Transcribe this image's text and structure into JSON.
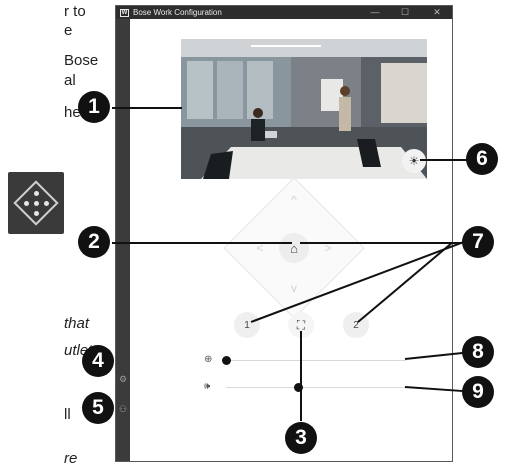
{
  "doc_text": {
    "lines_top": [
      "r to",
      "e",
      "Bose",
      "al",
      "here"
    ],
    "lines_mid": [
      "that",
      "utlet"
    ],
    "lines_low": [
      "ll",
      "re"
    ]
  },
  "window": {
    "title": "Bose Work Configuration",
    "logo_text": "W",
    "minimize": "—",
    "maximize": "☐",
    "close": "✕"
  },
  "sidebar": {
    "settings_icon": "⚙",
    "user_icon": "⚇"
  },
  "camera": {
    "brightness_icon": "☀"
  },
  "controls": {
    "home_icon": "⌂",
    "up_arrow": "^",
    "down_arrow": "v",
    "left_arrow": "<",
    "right_arrow": ">",
    "preset_1": "1",
    "preset_2": "2",
    "frame_icon": "⛶",
    "zoom": {
      "icon": "⊕",
      "value": 0.0
    },
    "volume": {
      "icon": "🕪",
      "value": 0.4
    }
  },
  "callouts": [
    "1",
    "2",
    "3",
    "4",
    "5",
    "6",
    "7",
    "8",
    "9"
  ]
}
